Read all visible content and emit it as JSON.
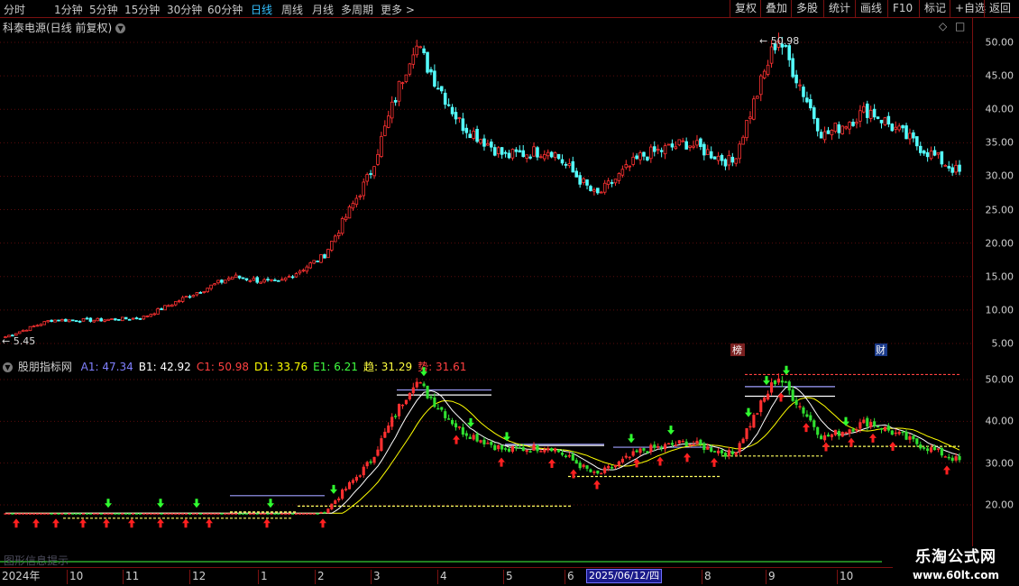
{
  "toolbar": {
    "periods": [
      "分时",
      "1分钟",
      "5分钟",
      "15分钟",
      "30分钟",
      "60分钟",
      "日线",
      "周线",
      "月线",
      "多周期",
      "更多 >"
    ],
    "active_period": "日线",
    "actions": [
      "复权",
      "叠加",
      "多股",
      "统计",
      "画线",
      "F10",
      "标记",
      "+自选",
      "返回"
    ]
  },
  "main_chart": {
    "title": "科泰电源(日线 前复权)",
    "high_label": "50.98",
    "low_label": "5.45",
    "event_badges": [
      "榜",
      "财"
    ]
  },
  "indicator": {
    "name": "股朋指标网",
    "items": [
      {
        "label": "A1:",
        "value": "47.34",
        "color": "#8080ff"
      },
      {
        "label": "B1:",
        "value": "42.92",
        "color": "#ffffff"
      },
      {
        "label": "C1:",
        "value": "50.98",
        "color": "#ff4040"
      },
      {
        "label": "D1:",
        "value": "33.76",
        "color": "#ffff00"
      },
      {
        "label": "E1:",
        "value": "6.21",
        "color": "#40ff40"
      },
      {
        "label": "趋:",
        "value": "31.29",
        "color": "#ffff40"
      },
      {
        "label": "势:",
        "value": "31.61",
        "color": "#ff4040"
      }
    ],
    "overlay_text": "图形信息提示"
  },
  "axes": {
    "main_ticks": [
      "50.00",
      "45.00",
      "40.00",
      "35.00",
      "30.00",
      "25.00",
      "20.00",
      "15.00",
      "10.00",
      "5.00"
    ],
    "indicator_ticks": [
      "50.00",
      "40.00",
      "30.00",
      "20.00"
    ],
    "time_labels": [
      "2024年",
      "10",
      "11",
      "12",
      "1",
      "2",
      "3",
      "4",
      "5",
      "6",
      "7",
      "8",
      "9",
      "10"
    ],
    "cursor_date": "2025/06/12/四"
  },
  "colors": {
    "up": "#ff3232",
    "down": "#54ffff",
    "grid": "#7a1010",
    "ma_fast": "#ffffff",
    "ma_slow": "#ffff00"
  },
  "chart_data": {
    "type": "candlestick",
    "symbol": "科泰电源",
    "period": "日线",
    "price_path": [
      {
        "date": "2024-09",
        "close": 6.0
      },
      {
        "date": "2024-10",
        "close": 8.5
      },
      {
        "date": "2024-11",
        "close": 8.5
      },
      {
        "date": "2024-12",
        "close": 8.8
      },
      {
        "date": "2025-01",
        "close": 12.0
      },
      {
        "date": "2025-01b",
        "close": 15.0
      },
      {
        "date": "2025-02",
        "close": 14.0
      },
      {
        "date": "2025-02b",
        "close": 18.0
      },
      {
        "date": "2025-03",
        "close": 30.0
      },
      {
        "date": "2025-03b",
        "close": 50.0
      },
      {
        "date": "2025-04",
        "close": 38.0
      },
      {
        "date": "2025-04b",
        "close": 33.0
      },
      {
        "date": "2025-05",
        "close": 34.0
      },
      {
        "date": "2025-06",
        "close": 27.0
      },
      {
        "date": "2025-07",
        "close": 33.0
      },
      {
        "date": "2025-07b",
        "close": 35.0
      },
      {
        "date": "2025-08",
        "close": 32.0
      },
      {
        "date": "2025-08b",
        "close": 50.98
      },
      {
        "date": "2025-09",
        "close": 36.0
      },
      {
        "date": "2025-09b",
        "close": 40.0
      },
      {
        "date": "2025-10",
        "close": 35.0
      },
      {
        "date": "2025-11",
        "close": 30.5
      }
    ],
    "main_ylim": [
      5,
      52
    ],
    "indicator_ylim": [
      15,
      52
    ]
  }
}
